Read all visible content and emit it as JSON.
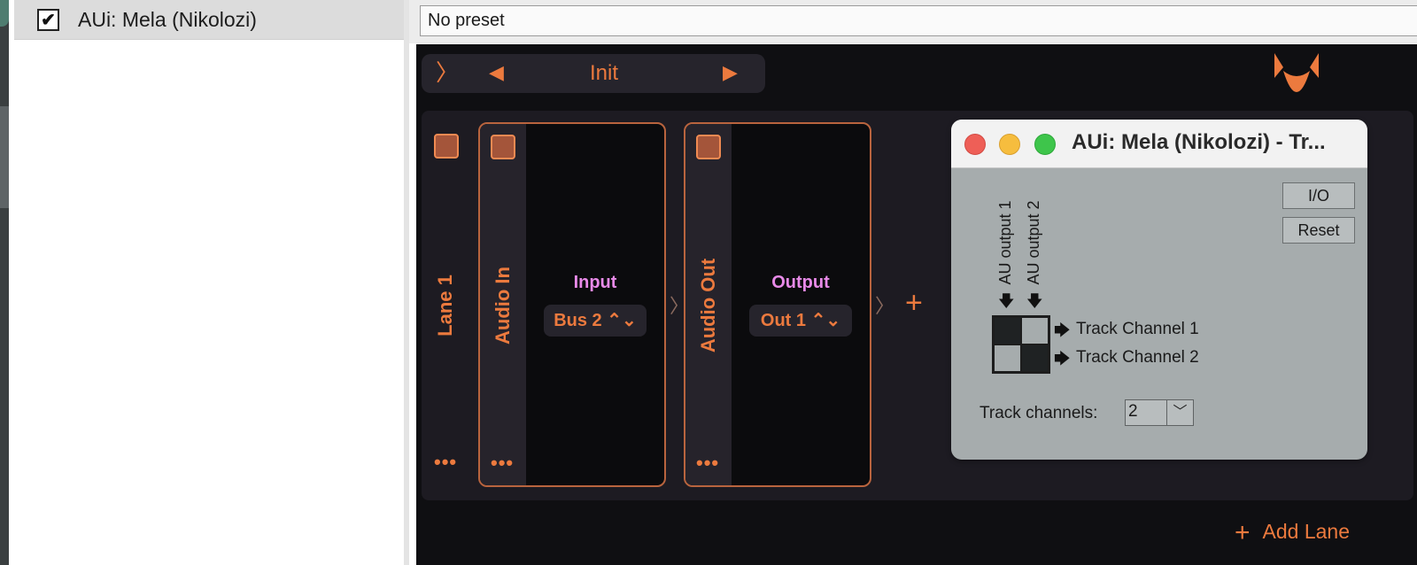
{
  "plugin_list": {
    "checked": true,
    "checkbox_glyph": "✔",
    "plugin_name": "AUi: Mela (Nikolozi)"
  },
  "preset": {
    "value": "No preset"
  },
  "editor": {
    "nav": {
      "toggle_icon": "chevron-right-icon",
      "toggle_glyph": "〉",
      "prev_glyph": "◀",
      "next_glyph": "▶",
      "title": "Init"
    },
    "lane": {
      "name": "Lane 1",
      "more_glyph": "•••",
      "modules": [
        {
          "name": "Audio In",
          "title": "Input",
          "select": "Bus 2 ⌃⌄",
          "more_glyph": "•••"
        },
        {
          "name": "Audio Out",
          "title": "Output",
          "select": "Out 1 ⌃⌄",
          "more_glyph": "•••"
        }
      ],
      "chevron": "〉",
      "add_glyph": "+"
    },
    "add_lane": {
      "plus": "+",
      "label": "Add Lane"
    },
    "accent_color": "#ec7a3e",
    "title_color": "#e88ae8"
  },
  "io_window": {
    "title": "AUi: Mela (Nikolozi) - Tr...",
    "buttons": {
      "io": "I/O",
      "reset": "Reset"
    },
    "outputs": [
      "AU output 1",
      "AU output 2"
    ],
    "arrow_down": "🡇",
    "arrow_right": "🡆",
    "channels": [
      "Track Channel 1",
      "Track Channel 2"
    ],
    "matrix": [
      [
        true,
        false
      ],
      [
        false,
        true
      ]
    ],
    "track_channels_label": "Track channels:",
    "track_channels_value": "2",
    "caret": "﹀",
    "traffic_lights": {
      "close": "#ee5f57",
      "minimize": "#f6bd3e",
      "zoom": "#3ec54b"
    }
  }
}
